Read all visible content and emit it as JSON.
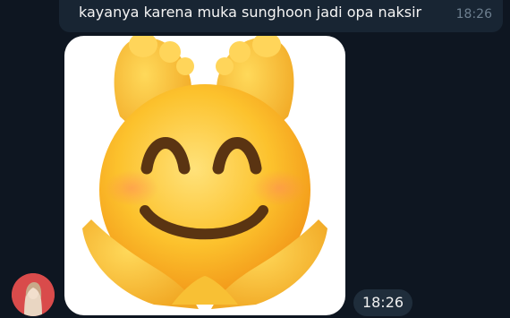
{
  "previous_message": {
    "text": "kayanya karena muka sunghoon jadi opa naksir",
    "time": "18:26"
  },
  "sticker_message": {
    "sticker_icon": "smiling-face-with-raised-feet-and-cupped-hands-emoji",
    "time": "18:26"
  },
  "sender": {
    "avatar_icon": "user-avatar"
  },
  "colors": {
    "background": "#0e1621",
    "bubble": "#182533",
    "time_pill": "#1f2d3b",
    "avatar_bg": "#d94b4b",
    "emoji_face": "#fcc22d"
  }
}
